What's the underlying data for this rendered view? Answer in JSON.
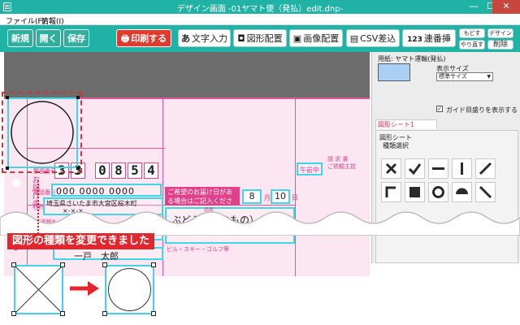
{
  "window": {
    "title": "デザイン画面 -01ヤマト便（発払）edit.dnp-",
    "minimize_glyph": "—",
    "maximize_glyph": "☐",
    "close_glyph": "✕"
  },
  "menu": {
    "items": [
      {
        "label": "ファイル(F)"
      },
      {
        "label": "情報(I)"
      }
    ]
  },
  "toolbar": {
    "new_label": "新規",
    "open_label": "開く",
    "save_label": "保存",
    "print_label": "印刷する",
    "text_input_label": "文字入力",
    "text_input_glyph": "あ",
    "shape_label": "図形配置",
    "image_label": "画像配置",
    "csv_label": "CSV差込",
    "serial_label": "連番挿入",
    "serial_glyph": "123",
    "undo_label": "もどす",
    "redo_label": "やり直す",
    "design_label": "デザイン",
    "delete_label": "削除"
  },
  "ticket": {
    "postal_code_digits": [
      "3",
      "3",
      "0",
      "8",
      "5",
      "4"
    ],
    "phone_placeholder": "000 0000 0000",
    "address": "埼玉県さいたま市大宮区桜木町",
    "address_line2": "×-×-×",
    "name": "一戸　太郎",
    "item_name": "ぶどう（なまもの）",
    "banner": "ご希望のお届け日がある場合はご記入ください。",
    "month": "8",
    "month_unit": "月",
    "day": "10",
    "day_unit": "日",
    "time_label": "午前中",
    "invoice_label": "請 求 書\nご依頼主控",
    "label_small_1": "お届け先",
    "label_small_2": "品名",
    "label_small_3": "ご依頼主",
    "label_small_4": "電話番号",
    "label_small_5": "郵便番号",
    "label_small_6": "住所",
    "label_small_7": "ビル・スキー・ゴルフ等"
  },
  "panel": {
    "paper_label": "用紙: ヤマト運輸(発払)",
    "display_size_label": "表示サイズ",
    "display_size_value": "標準サイズ",
    "guide_checkbox_label": "ガイド目盛りを表示する",
    "section_tab_label": "図形シート1",
    "group_label": "図形シート",
    "subgroup_label": "種類選択",
    "shapes": [
      {
        "name": "cross",
        "glyph": "✕"
      },
      {
        "name": "check",
        "glyph": "✔"
      },
      {
        "name": "horizontal-line",
        "glyph": "━"
      },
      {
        "name": "vertical-line",
        "glyph": "┃"
      },
      {
        "name": "diagonal-line",
        "glyph": "╱"
      },
      {
        "name": "bracket",
        "glyph": "⌐"
      },
      {
        "name": "filled-square",
        "glyph": "■"
      },
      {
        "name": "circle",
        "glyph": "○"
      },
      {
        "name": "half-circle",
        "glyph": "◒"
      },
      {
        "name": "back-diagonal",
        "glyph": "╲"
      }
    ]
  },
  "annotation": {
    "caption": "図形の種類を変更できました"
  },
  "colors": {
    "teal": "#21b2a6",
    "print_red": "#e23a2c",
    "ticket_pink": "#fce6f1",
    "guide_cyan": "#3fd7e8",
    "caption_red": "#e1272d"
  }
}
